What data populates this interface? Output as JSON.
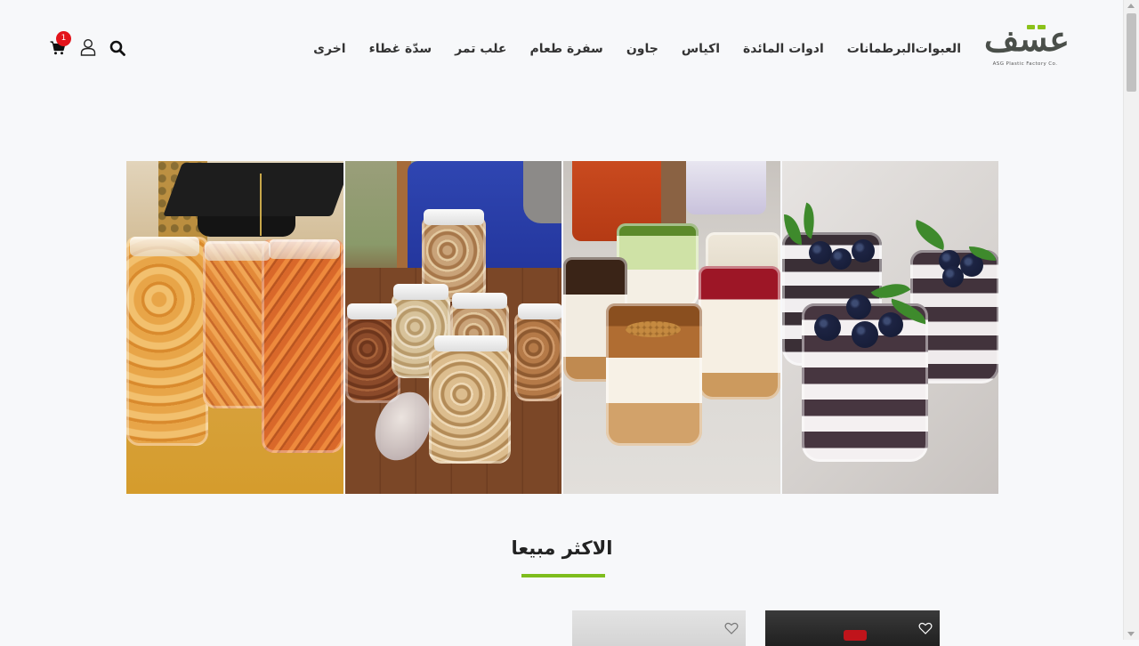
{
  "brand": {
    "logo_text": "عسف",
    "logo_subtitle": "ASG Plastic Factory Co.",
    "accent_color": "#8bc21a"
  },
  "nav": {
    "items": [
      {
        "label": "العبوات"
      },
      {
        "label": "البرطمانات"
      },
      {
        "label": "ادوات المائدة"
      },
      {
        "label": "اكياس"
      },
      {
        "label": "جاون"
      },
      {
        "label": "سفرة طعام"
      },
      {
        "label": "علب تمر"
      },
      {
        "label": "سدّة غطاء"
      },
      {
        "label": "اخرى"
      }
    ]
  },
  "header_icons": {
    "search": "search-icon",
    "account": "user-icon",
    "cart": "cart-icon",
    "cart_count": "1",
    "badge_color": "#e3141b"
  },
  "hero": {
    "panels": [
      {
        "subject": "snacks-jars"
      },
      {
        "subject": "nuts-jars"
      },
      {
        "subject": "dessert-cups"
      },
      {
        "subject": "blueberry-dessert-cups"
      }
    ]
  },
  "best_sellers": {
    "title": "الاكثر مبيعا",
    "underline_color": "#7ebd1d",
    "wishlist_icon": "heart-icon"
  }
}
